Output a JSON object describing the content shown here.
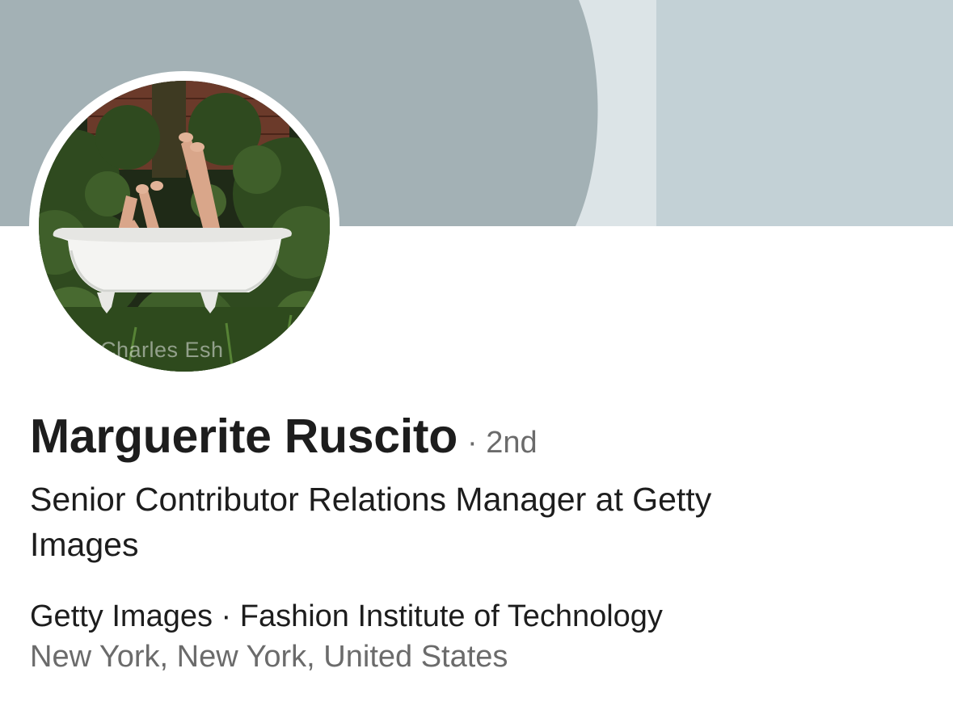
{
  "profile": {
    "name": "Marguerite Ruscito",
    "degree": "· 2nd",
    "headline": "Senior Contributor Relations Manager at Getty Images",
    "affiliation": "Getty Images · Fashion Institute of Technology",
    "location": "New York, New York, United States",
    "avatar_watermark": "Charles Esh"
  },
  "colors": {
    "cover_left": "#a3b1b5",
    "cover_mid": "#dce4e7",
    "cover_right": "#c3d1d6",
    "name_text": "#1d1d1d",
    "secondary_text": "#6b6b6b"
  }
}
